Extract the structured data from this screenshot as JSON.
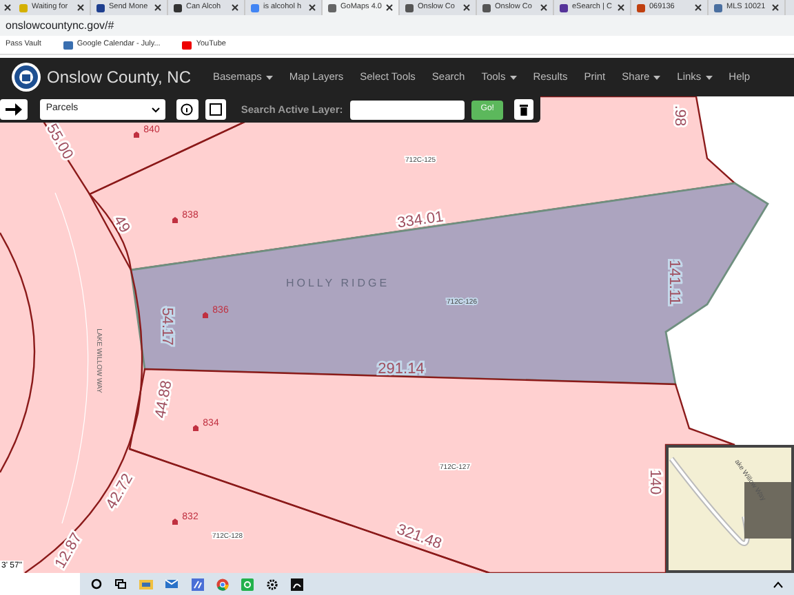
{
  "browser": {
    "tabs": [
      {
        "label": "Waiting for",
        "selected": false
      },
      {
        "label": "Send Mone",
        "selected": false
      },
      {
        "label": "Can Alcoh",
        "selected": false
      },
      {
        "label": "is alcohol h",
        "selected": false
      },
      {
        "label": "GoMaps 4.0",
        "selected": true
      },
      {
        "label": "Onslow Co",
        "selected": false
      },
      {
        "label": "Onslow Co",
        "selected": false
      },
      {
        "label": "eSearch | C",
        "selected": false
      },
      {
        "label": "069136",
        "selected": false
      },
      {
        "label": "MLS 10021",
        "selected": false
      }
    ],
    "address": "onslowcountync.gov/#",
    "bookmarks": [
      "Pass Vault",
      "Google Calendar - July...",
      "YouTube"
    ]
  },
  "app": {
    "title": "Onslow County, NC",
    "menu": [
      {
        "label": "Basemaps",
        "has_dropdown": true
      },
      {
        "label": "Map Layers",
        "has_dropdown": false
      },
      {
        "label": "Select Tools",
        "has_dropdown": false
      },
      {
        "label": "Search",
        "has_dropdown": false
      },
      {
        "label": "Tools",
        "has_dropdown": true
      },
      {
        "label": "Results",
        "has_dropdown": false
      },
      {
        "label": "Print",
        "has_dropdown": false
      },
      {
        "label": "Share",
        "has_dropdown": true
      },
      {
        "label": "Links",
        "has_dropdown": true
      },
      {
        "label": "Help",
        "has_dropdown": false
      }
    ]
  },
  "toolbar": {
    "layer": "Parcels",
    "search_label": "Search Active Layer:",
    "go_button": "Go!"
  },
  "map": {
    "parcels": [
      {
        "selected": false
      },
      {
        "selected": true
      },
      {
        "selected": false
      }
    ],
    "labels": [
      {
        "kind": "dimension",
        "text": ".98"
      },
      {
        "kind": "address",
        "text": "840"
      },
      {
        "kind": "dimension",
        "text": "55.00"
      },
      {
        "kind": "parcel_id",
        "text": "712C-125"
      },
      {
        "kind": "address",
        "text": "838"
      },
      {
        "kind": "dimension",
        "text": "49"
      },
      {
        "kind": "dimension",
        "text": "334.01"
      },
      {
        "kind": "subdivision",
        "text": "HOLLY RIDGE"
      },
      {
        "kind": "parcel_id",
        "text": "712C-126"
      },
      {
        "kind": "address",
        "text": "836"
      },
      {
        "kind": "dimension",
        "text": "54.17"
      },
      {
        "kind": "dimension",
        "text": "141.11"
      },
      {
        "kind": "street",
        "text": "LAKE WILLOW WAY"
      },
      {
        "kind": "dimension",
        "text": "291.14"
      },
      {
        "kind": "dimension",
        "text": "44.88"
      },
      {
        "kind": "address",
        "text": "834"
      },
      {
        "kind": "parcel_id",
        "text": "712C-127"
      },
      {
        "kind": "dimension",
        "text": "140"
      },
      {
        "kind": "dimension",
        "text": "42.72"
      },
      {
        "kind": "address",
        "text": "832"
      },
      {
        "kind": "parcel_id",
        "text": "712C-128"
      },
      {
        "kind": "dimension",
        "text": "321.48"
      },
      {
        "kind": "dimension",
        "text": "12.87"
      }
    ],
    "coordinate_readout": "3' 57\"",
    "overview_road_label": "ake Willow Way"
  }
}
